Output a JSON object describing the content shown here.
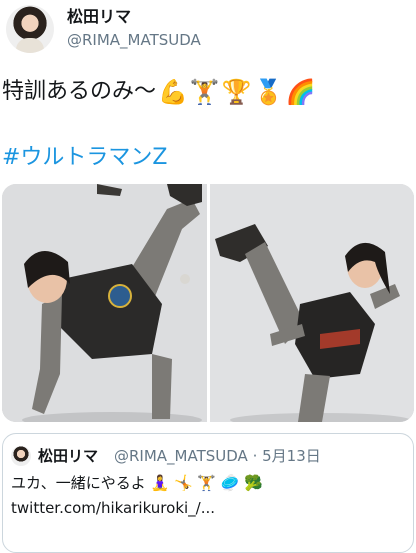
{
  "tweet": {
    "author": {
      "display_name": "松田リマ",
      "handle": "@RIMA_MATSUDA"
    },
    "text": "特訓あるのみ〜",
    "emojis": [
      "💪",
      "🏋️",
      "🏆",
      "🏅",
      "🌈"
    ],
    "hashtag": "#ウルトラマンZ",
    "media": [
      {
        "icon": "photo-kick-pose-icon"
      },
      {
        "icon": "photo-high-kick-icon"
      }
    ]
  },
  "quoted_tweet": {
    "author": {
      "display_name": "松田リマ",
      "handle": "@RIMA_MATSUDA",
      "date": "5月13日"
    },
    "text": "ユカ、一緒にやるよ",
    "emojis": [
      "🧘‍♀️",
      "🤸",
      "🏋️",
      "🥏",
      "🥦"
    ],
    "link": "twitter.com/hikarikuroki_/..."
  },
  "colors": {
    "link": "#1b95e0",
    "secondary_text": "#657786",
    "border": "#ccd6dd"
  }
}
